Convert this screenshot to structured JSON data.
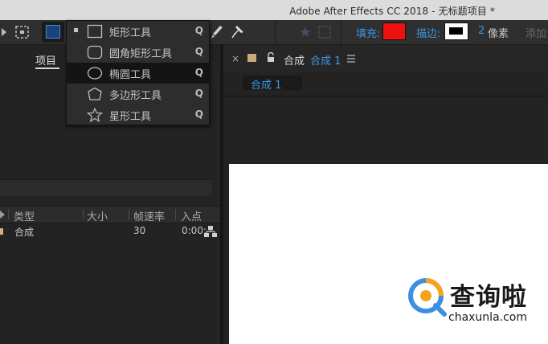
{
  "window": {
    "title": "Adobe After Effects CC 2018 - 无标题项目 *"
  },
  "toolbar": {
    "fill_label": "填充:",
    "fill_color": "#ee1111",
    "stroke_label": "描边:",
    "stroke_width_value": "2",
    "stroke_unit": "像素",
    "add_label": "添加",
    "accent": "#3a98e6"
  },
  "shape_menu": {
    "items": [
      {
        "label": "矩形工具",
        "shortcut": "Q",
        "icon": "rectangle-icon",
        "checked": true,
        "highlighted": false
      },
      {
        "label": "圆角矩形工具",
        "shortcut": "Q",
        "icon": "rounded-rectangle-icon",
        "checked": false,
        "highlighted": false
      },
      {
        "label": "椭圆工具",
        "shortcut": "Q",
        "icon": "ellipse-icon",
        "checked": false,
        "highlighted": true
      },
      {
        "label": "多边形工具",
        "shortcut": "Q",
        "icon": "polygon-icon",
        "checked": false,
        "highlighted": false
      },
      {
        "label": "星形工具",
        "shortcut": "Q",
        "icon": "star-icon",
        "checked": false,
        "highlighted": false
      }
    ]
  },
  "project_panel": {
    "tab_label": "项目",
    "columns": [
      "类型",
      "大小",
      "帧速率",
      "入点"
    ],
    "rows": [
      {
        "type": "合成",
        "size": "",
        "fps": "30",
        "in_point": "0:00:"
      }
    ]
  },
  "comp_panel": {
    "tab_label": "合成",
    "comp_name": "合成 1",
    "subtab_label": "合成 1"
  },
  "watermark": {
    "name": "查询啦",
    "url": "chaxunla.com"
  }
}
